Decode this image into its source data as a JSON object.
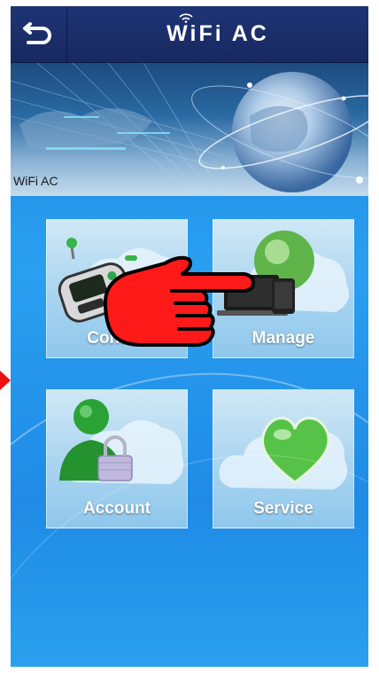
{
  "header": {
    "title": "WiFi AC",
    "back_icon": "back-arrow-icon"
  },
  "banner": {
    "caption": "WiFi AC",
    "image": "world-globe-network-image",
    "page_indicator_count": 1
  },
  "tiles": [
    {
      "label": "Control",
      "icon": "remote-control-icon"
    },
    {
      "label": "Manage",
      "icon": "devices-globe-icon"
    },
    {
      "label": "Account",
      "icon": "user-lock-icon"
    },
    {
      "label": "Service",
      "icon": "heart-icon"
    }
  ],
  "overlay": {
    "pointer": "pointing-hand-icon",
    "side_marker": "red-arrow-icon"
  },
  "colors": {
    "header_bg": "#1e3476",
    "screen_bg": "#2a9ff0",
    "tile_bg": "#a9d4ef",
    "overlay_red": "#ee1111"
  }
}
